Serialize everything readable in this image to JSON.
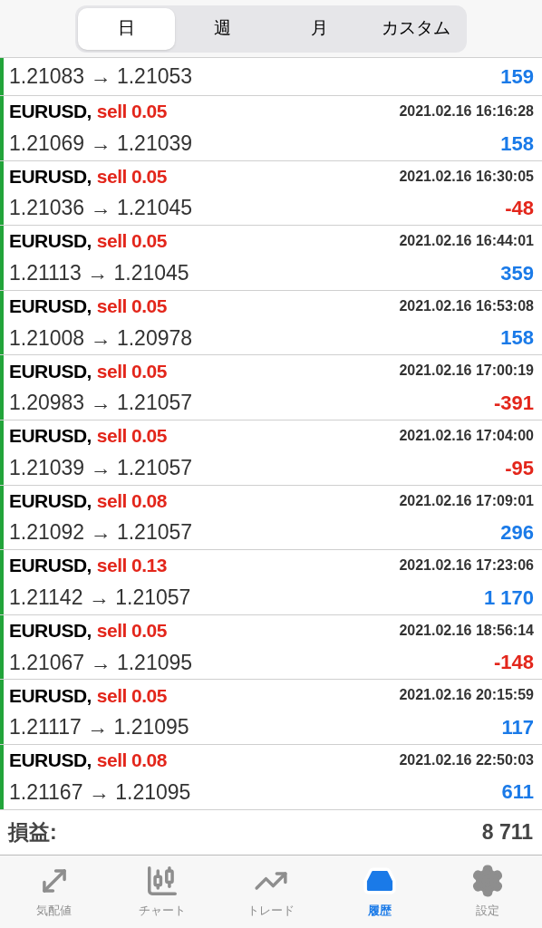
{
  "period_tabs": [
    {
      "label": "日",
      "selected": true
    },
    {
      "label": "週",
      "selected": false
    },
    {
      "label": "月",
      "selected": false
    },
    {
      "label": "カスタム",
      "selected": false
    }
  ],
  "partial_row": {
    "prices": "1.21083 → 1.21053",
    "profit": "159",
    "color": "#1a7ae8"
  },
  "deals": [
    {
      "symbol": "EURUSD,",
      "order": "sell 0.05",
      "time": "2021.02.16 16:16:28",
      "prices": "1.21069 → 1.21039",
      "profit": "158",
      "color": "#1a7ae8"
    },
    {
      "symbol": "EURUSD,",
      "order": "sell 0.05",
      "time": "2021.02.16 16:30:05",
      "prices": "1.21036 → 1.21045",
      "profit": "-48",
      "color": "#e3261b"
    },
    {
      "symbol": "EURUSD,",
      "order": "sell 0.05",
      "time": "2021.02.16 16:44:01",
      "prices": "1.21113 → 1.21045",
      "profit": "359",
      "color": "#1a7ae8"
    },
    {
      "symbol": "EURUSD,",
      "order": "sell 0.05",
      "time": "2021.02.16 16:53:08",
      "prices": "1.21008 → 1.20978",
      "profit": "158",
      "color": "#1a7ae8"
    },
    {
      "symbol": "EURUSD,",
      "order": "sell 0.05",
      "time": "2021.02.16 17:00:19",
      "prices": "1.20983 → 1.21057",
      "profit": "-391",
      "color": "#e3261b"
    },
    {
      "symbol": "EURUSD,",
      "order": "sell 0.05",
      "time": "2021.02.16 17:04:00",
      "prices": "1.21039 → 1.21057",
      "profit": "-95",
      "color": "#e3261b"
    },
    {
      "symbol": "EURUSD,",
      "order": "sell 0.08",
      "time": "2021.02.16 17:09:01",
      "prices": "1.21092 → 1.21057",
      "profit": "296",
      "color": "#1a7ae8"
    },
    {
      "symbol": "EURUSD,",
      "order": "sell 0.13",
      "time": "2021.02.16 17:23:06",
      "prices": "1.21142 → 1.21057",
      "profit": "1 170",
      "color": "#1a7ae8"
    },
    {
      "symbol": "EURUSD,",
      "order": "sell 0.05",
      "time": "2021.02.16 18:56:14",
      "prices": "1.21067 → 1.21095",
      "profit": "-148",
      "color": "#e3261b"
    },
    {
      "symbol": "EURUSD,",
      "order": "sell 0.05",
      "time": "2021.02.16 20:15:59",
      "prices": "1.21117 → 1.21095",
      "profit": "117",
      "color": "#1a7ae8"
    },
    {
      "symbol": "EURUSD,",
      "order": "sell 0.08",
      "time": "2021.02.16 22:50:03",
      "prices": "1.21167 → 1.21095",
      "profit": "611",
      "color": "#1a7ae8"
    }
  ],
  "summary": {
    "label": "損益:",
    "value": "8 711"
  },
  "bottom_tabs": [
    {
      "kind": "quotes",
      "label": "気配値",
      "selected": false
    },
    {
      "kind": "chart",
      "label": "チャート",
      "selected": false
    },
    {
      "kind": "trade",
      "label": "トレード",
      "selected": false
    },
    {
      "kind": "history",
      "label": "履歴",
      "selected": true
    },
    {
      "kind": "settings",
      "label": "設定",
      "selected": false
    }
  ]
}
